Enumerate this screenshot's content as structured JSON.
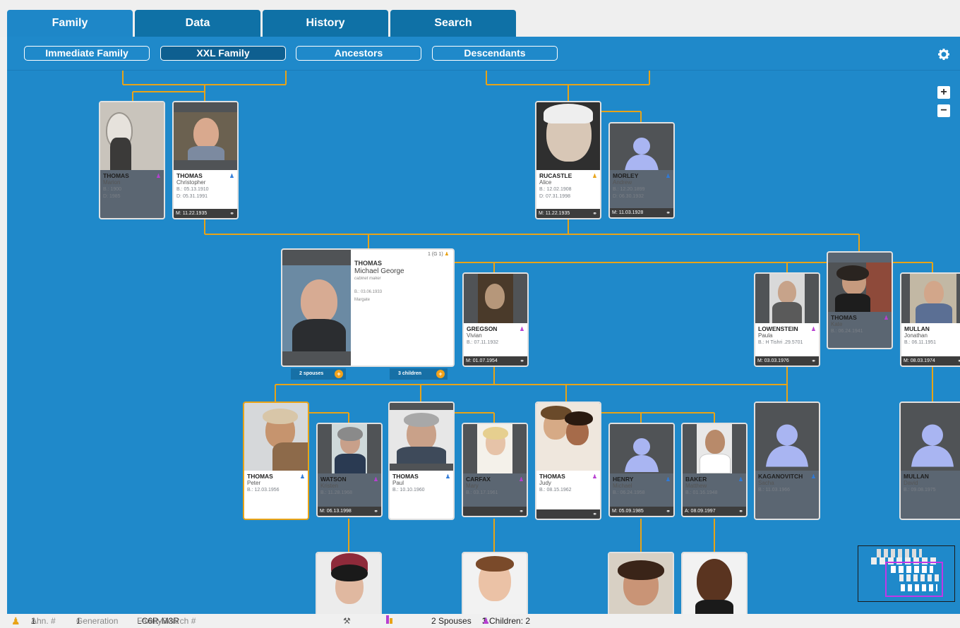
{
  "tabs": [
    {
      "label": "Family",
      "active": true
    },
    {
      "label": "Data",
      "active": false
    },
    {
      "label": "History",
      "active": false
    },
    {
      "label": "Search",
      "active": false
    }
  ],
  "subtabs": [
    {
      "label": "Immediate Family",
      "active": false
    },
    {
      "label": "XXL Family",
      "active": true
    },
    {
      "label": "Ancestors",
      "active": false
    },
    {
      "label": "Descendants",
      "active": false
    }
  ],
  "toolbar": {
    "settings_icon": "gear-icon",
    "zoom_in": "+",
    "zoom_out": "−"
  },
  "people": {
    "marion": {
      "surname": "THOMAS",
      "given": "Marion",
      "born": "B.: 1900",
      "died": "D: 1985",
      "sex": "f"
    },
    "christopher": {
      "surname": "THOMAS",
      "given": "Christopher",
      "born": "B.: 05.13.1910",
      "died": "D: 05.31.1991",
      "sex": "m",
      "marriage": "M: 11.22.1935"
    },
    "alice": {
      "surname": "RUCASTLE",
      "given": "Alice",
      "born": "B.: 12.02.1908",
      "died": "D: 07.31.1998",
      "sex": "f",
      "marriage": "M: 11.22.1935"
    },
    "andrew": {
      "surname": "MORLEY",
      "given": "Andrew",
      "born": "B.: 12.20.1899",
      "died": "D: 06.30.1932",
      "sex": "m",
      "marriage": "M: 11.03.1928"
    },
    "vivian": {
      "surname": "GREGSON",
      "given": "Vivian",
      "born": "B.: 07.11.1932",
      "sex": "f",
      "marriage": "M: 01.07.1954"
    },
    "paula": {
      "surname": "LOWENSTEIN",
      "given": "Paula",
      "born": "B.: H Tishri .29.5701",
      "sex": "f",
      "marriage": "M: 03.03.1976"
    },
    "kate": {
      "surname": "THOMAS",
      "given": "Kate",
      "born": "B.: 06.24.1941",
      "sex": "f"
    },
    "jonathan": {
      "surname": "MULLAN",
      "given": "Jonathan",
      "born": "B.: 06.11.1951",
      "sex": "m",
      "marriage": "M: 08.03.1974"
    },
    "peter": {
      "surname": "THOMAS",
      "given": "Peter",
      "born": "B.: 12.03.1956",
      "sex": "m"
    },
    "kristen": {
      "surname": "WATSON",
      "given": "Kristen",
      "born": "B.: 11.28.1968",
      "sex": "f",
      "marriage": "M: 06.13.1998"
    },
    "paul": {
      "surname": "THOMAS",
      "given": "Paul",
      "born": "B.: 10.10.1960",
      "sex": "m"
    },
    "mary": {
      "surname": "CARFAX",
      "given": "Mary",
      "born": "B.: 03.17.1961",
      "sex": "f"
    },
    "judy": {
      "surname": "THOMAS",
      "given": "Judy",
      "born": "B.: 08.15.1962",
      "sex": "f"
    },
    "michael": {
      "surname": "HENRY",
      "given": "Michael",
      "born": "B.: 06.24.1958",
      "sex": "m",
      "marriage": "M: 05.09.1985"
    },
    "matthew": {
      "surname": "BAKER",
      "given": "Matthew",
      "born": "B.: 01.16.1948",
      "sex": "m",
      "marriage": "A: 08.09.1997"
    },
    "sacha": {
      "surname": "KAGANOVITCH",
      "given": "Sacha",
      "born": "B.: 11.03.1966",
      "sex": "m"
    },
    "david": {
      "surname": "MULLAN",
      "given": "David",
      "born": "B.: 09.08.1975",
      "sex": "m"
    }
  },
  "focus": {
    "surname": "THOMAS",
    "given": "Michael George",
    "occupation": "cabinet maker",
    "born": "B.: 03.06.1933",
    "place": "Margate",
    "badge": "1 (G 1)",
    "spouses_pill": "2 spouses",
    "children_pill": "3 children"
  },
  "status": {
    "ahn_label": "Ahn. #",
    "ahn_value": "1",
    "generation_label": "Generation",
    "generation_value": "1",
    "fs_label": "FamilySearch #",
    "fs_value": "LC6R-M3R",
    "spouses": "2 Spouses",
    "children_label": "3 Children: 2",
    "daughters": "1"
  },
  "colors": {
    "accent": "#1f89ca",
    "tab": "#0f71a6",
    "line": "#e8a317",
    "male": "#2f7ad8",
    "female": "#b73fd1"
  }
}
